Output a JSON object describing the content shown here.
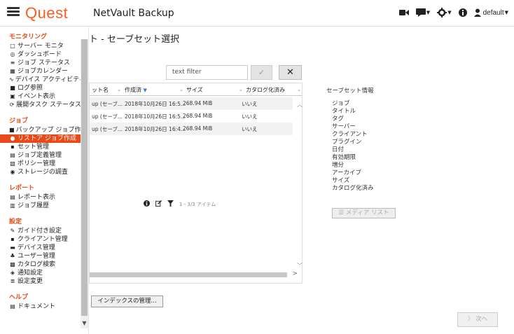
{
  "header": {
    "logo": "Quest",
    "app_title": "NetVault Backup",
    "user": "default",
    "icons": [
      "menu-icon",
      "video-icon",
      "chat-icon",
      "settings-icon",
      "info-icon",
      "user-icon"
    ]
  },
  "sidebar": {
    "sections": [
      {
        "title": "モニタリング",
        "items": [
          {
            "icon": "□",
            "label": "サーバー モニタ"
          },
          {
            "icon": "◎",
            "label": "ダッシュボード"
          },
          {
            "icon": "≡",
            "label": "ジョブ ステータス"
          },
          {
            "icon": "▦",
            "label": "ジョブカレンダー"
          },
          {
            "icon": "∿",
            "label": "デバイス アクティビティ"
          },
          {
            "icon": "■",
            "label": "ログ参照"
          },
          {
            "icon": "▣",
            "label": "イベント表示"
          },
          {
            "icon": "⟳",
            "label": "展開タスク ステータス"
          }
        ]
      },
      {
        "title": "ジョブ",
        "items": [
          {
            "icon": "■",
            "label": "バックアップ ジョブ作成"
          },
          {
            "icon": "●",
            "label": "リストア ジョブ作成",
            "active": true
          },
          {
            "icon": "▪",
            "label": "セット管理"
          },
          {
            "icon": "▤",
            "label": "ジョブ定義管理"
          },
          {
            "icon": "▧",
            "label": "ポリシー管理"
          },
          {
            "icon": "◉",
            "label": "ストレージの調査"
          }
        ]
      },
      {
        "title": "レポート",
        "items": [
          {
            "icon": "▤",
            "label": "レポート表示"
          },
          {
            "icon": "▥",
            "label": "ジョブ履歴"
          }
        ]
      },
      {
        "title": "設定",
        "items": [
          {
            "icon": "✎",
            "label": "ガイド付き設定"
          },
          {
            "icon": "▪",
            "label": "クライアント管理"
          },
          {
            "icon": "▬",
            "label": "デバイス管理"
          },
          {
            "icon": "♣",
            "label": "ユーザー管理"
          },
          {
            "icon": "▩",
            "label": "カタログ検索"
          },
          {
            "icon": "◈",
            "label": "通知設定"
          },
          {
            "icon": "≣",
            "label": "設定変更"
          }
        ]
      },
      {
        "title": "ヘルプ",
        "items": [
          {
            "icon": "▤",
            "label": "ドキュメント"
          }
        ]
      }
    ]
  },
  "page": {
    "heading": "ト - セーブセット選択"
  },
  "filter": {
    "placeholder": "text filter",
    "check_icon": "✓",
    "clear_icon": "✕"
  },
  "table": {
    "columns": [
      "ット名",
      "作成済",
      "サイズ",
      "カタログ化済み"
    ],
    "sorted_column": "作成済",
    "rows": [
      [
        "up (セーブ...",
        "2018年10月26日 16:5...",
        "268.94 MiB",
        "いいえ"
      ],
      [
        "up (セーブ...",
        "2018年10月26日 16:5...",
        "268.94 MiB",
        "いいえ"
      ],
      [
        "up (セーブ...",
        "2018年10月26日 16:4...",
        "268.94 MiB",
        "いいえ"
      ]
    ],
    "footer_count": "1 - 3/3 アイテム"
  },
  "index_button": "インデックスの管理...",
  "info_panel": {
    "title": "セーブセット情報",
    "fields": [
      "ジョブ",
      "タイトル",
      "タグ",
      "サーバー",
      "クライアント",
      "プラグイン",
      "日付",
      "有効期限",
      "増分",
      "アーカイブ",
      "サイズ",
      "カタログ化済み"
    ],
    "media_button": "☰ メディア リスト"
  },
  "next_button": "〉 次へ",
  "colors": {
    "accent": "#e74a18",
    "logo": "#ff5a1f"
  }
}
